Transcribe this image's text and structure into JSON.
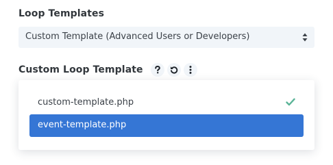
{
  "loop_templates": {
    "label": "Loop Templates",
    "selected_value": "Custom Template (Advanced Users or Developers)"
  },
  "custom_loop_template": {
    "label": "Custom Loop Template",
    "help_icon": "question-mark-icon",
    "reset_icon": "reset-undo-icon",
    "more_icon": "vertical-ellipsis-icon",
    "options": [
      {
        "label": "custom-template.php",
        "checked": true
      },
      {
        "label": "event-template.php",
        "highlighted": true
      }
    ]
  },
  "colors": {
    "accent_blue": "#3576d5",
    "check_green": "#5ab497",
    "field_background": "#f1f5f9",
    "label_text": "#32373c"
  }
}
